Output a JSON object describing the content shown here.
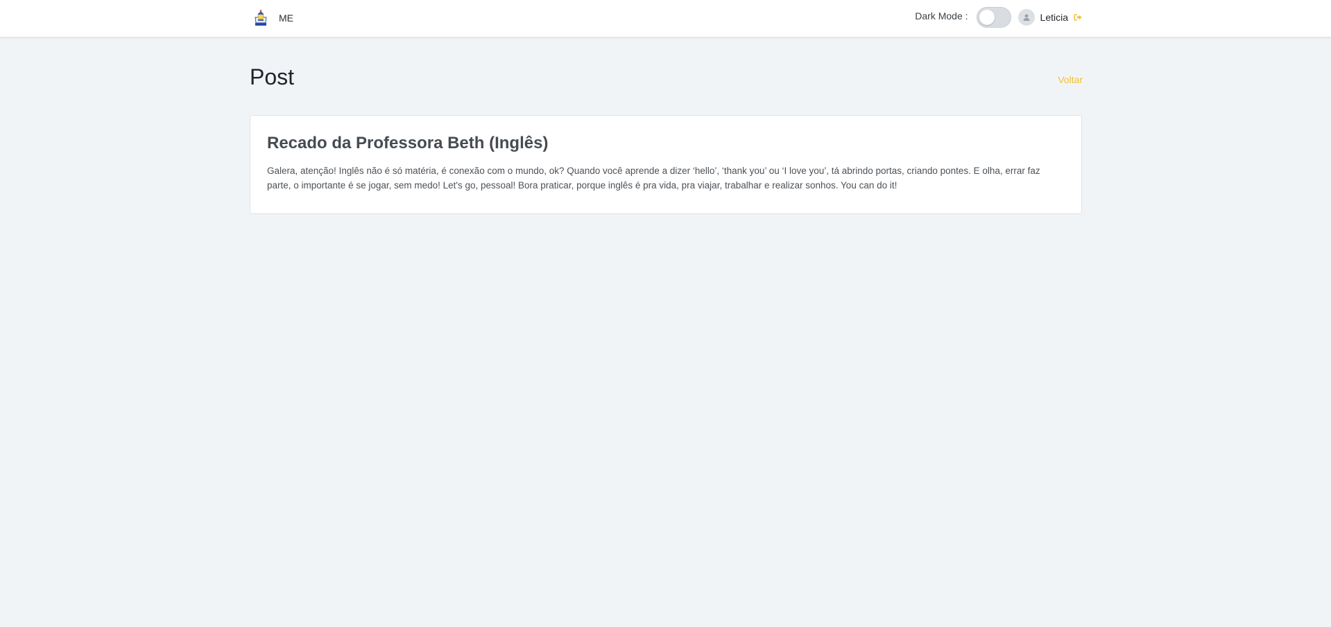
{
  "header": {
    "brand_text": "ME",
    "dark_mode_label": "Dark Mode :",
    "dark_mode_enabled": false,
    "user_name": "Leticia",
    "logo_icon": "school-crest-icon",
    "avatar_icon": "user-avatar-icon",
    "logout_icon": "logout-icon"
  },
  "page": {
    "title": "Post",
    "back_label": "Voltar"
  },
  "post": {
    "title": "Recado da Professora Beth (Inglês)",
    "body": "Galera, atenção! Inglês não é só matéria, é conexão com o mundo, ok? Quando você aprende a dizer ‘hello’, ‘thank you’ ou ‘I love you’, tá abrindo portas, criando pontes. E olha, errar faz parte, o importante é se jogar, sem medo! Let's go, pessoal! Bora praticar, porque inglês é pra vida, pra viajar, trabalhar e realizar sonhos. You can do it!"
  },
  "colors": {
    "background": "#f1f4f7",
    "accent": "#f2c230",
    "card_title": "#454b52"
  }
}
